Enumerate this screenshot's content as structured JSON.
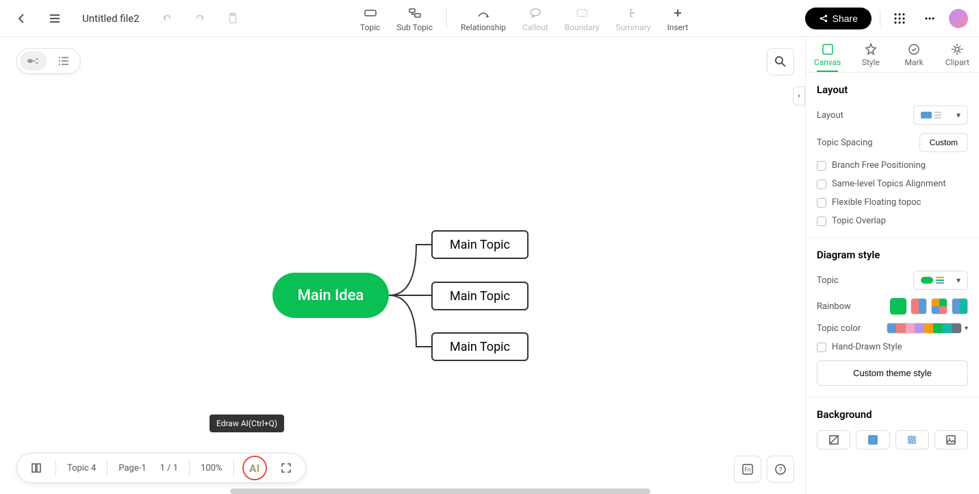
{
  "header": {
    "filename": "Untitled file2",
    "tools": {
      "topic": "Topic",
      "subtopic": "Sub Topic",
      "relationship": "Relationship",
      "callout": "Callout",
      "boundary": "Boundary",
      "summary": "Summary",
      "insert": "Insert"
    },
    "share": "Share"
  },
  "mindmap": {
    "main_idea": "Main Idea",
    "topics": [
      "Main Topic",
      "Main Topic",
      "Main Topic"
    ]
  },
  "tooltip": "Edraw AI(Ctrl+Q)",
  "bottom": {
    "topic_count": "Topic 4",
    "page": "Page-1",
    "page_nums": "1 / 1",
    "zoom": "100%",
    "ai_label": "AI"
  },
  "panel": {
    "tabs": {
      "canvas": "Canvas",
      "style": "Style",
      "mark": "Mark",
      "clipart": "Clipart"
    },
    "layout": {
      "title": "Layout",
      "layout_label": "Layout",
      "spacing_label": "Topic Spacing",
      "custom": "Custom",
      "branch_free": "Branch Free Positioning",
      "same_level": "Same-level Topics Alignment",
      "flexible": "Flexible Floating topoc",
      "overlap": "Topic Overlap"
    },
    "diagram_style": {
      "title": "Diagram style",
      "topic_label": "Topic",
      "rainbow_label": "Rainbow",
      "topic_color_label": "Topic color",
      "hand_drawn": "Hand-Drawn Style",
      "custom_theme": "Custom theme style"
    },
    "background": {
      "title": "Background"
    }
  },
  "colors": {
    "accent": "#0abf53",
    "topic_palette": [
      "#5b9bd5",
      "#ed7d7d",
      "#f4a6c0",
      "#b794f4",
      "#f59e0b",
      "#0abf53",
      "#14b8a6",
      "#6b7280"
    ]
  }
}
